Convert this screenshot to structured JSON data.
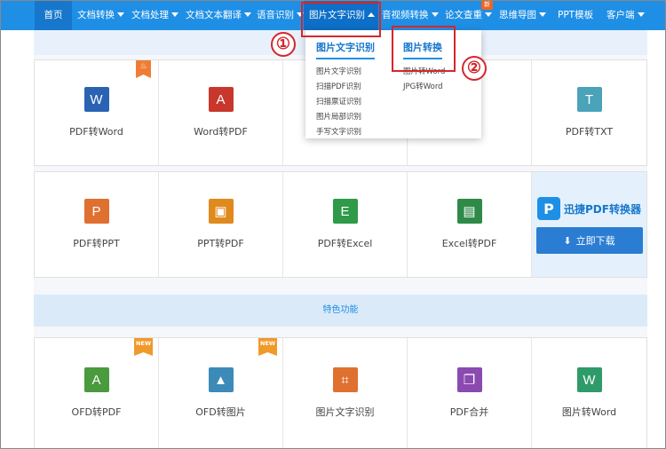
{
  "nav": {
    "home": "首页",
    "items": [
      "文档转换",
      "文档处理",
      "文档文本翻译",
      "语音识别",
      "图片文字识别",
      "音视频转换",
      "论文查重",
      "思维导图",
      "PPT模板",
      "客户端"
    ],
    "new_badge": "新"
  },
  "dropdown": {
    "col1_title": "图片文字识别",
    "col1_items": [
      "图片文字识别",
      "扫描PDF识别",
      "扫描票证识别",
      "图片局部识别",
      "手写文字识别"
    ],
    "col2_title": "图片转换",
    "col2_items": [
      "图片转Word",
      "JPG转Word"
    ]
  },
  "annotations": {
    "one": "①",
    "two": "②"
  },
  "row1": [
    {
      "label": "PDF转Word",
      "icon": "W",
      "color": "#2b63b4",
      "badge": "fire"
    },
    {
      "label": "Word转PDF",
      "icon": "A",
      "color": "#c8362c"
    },
    {
      "label": "",
      "icon": "",
      "color": ""
    },
    {
      "label": "",
      "icon": "",
      "color": ""
    },
    {
      "label": "PDF转TXT",
      "icon": "T",
      "color": "#4aa3b8"
    }
  ],
  "row2": [
    {
      "label": "PDF转PPT",
      "icon": "P",
      "color": "#e07030"
    },
    {
      "label": "PPT转PDF",
      "icon": "▣",
      "color": "#e08a1e"
    },
    {
      "label": "PDF转Excel",
      "icon": "E",
      "color": "#2f9a4a"
    },
    {
      "label": "Excel转PDF",
      "icon": "▤",
      "color": "#2f8a48"
    }
  ],
  "promo": {
    "brand": "迅捷PDF转换器",
    "logo": "P",
    "download": "立即下载"
  },
  "section_title": "特色功能",
  "row3": [
    {
      "label": "OFD转PDF",
      "icon": "A",
      "color": "#4a9a3e",
      "badge": "NEW"
    },
    {
      "label": "OFD转图片",
      "icon": "▲",
      "color": "#3c8ab8",
      "badge": "NEW"
    },
    {
      "label": "图片文字识别",
      "icon": "⌗",
      "color": "#e07030"
    },
    {
      "label": "PDF合并",
      "icon": "❐",
      "color": "#8a4ab0"
    },
    {
      "label": "图片转Word",
      "icon": "W",
      "color": "#2f9a6a"
    }
  ]
}
